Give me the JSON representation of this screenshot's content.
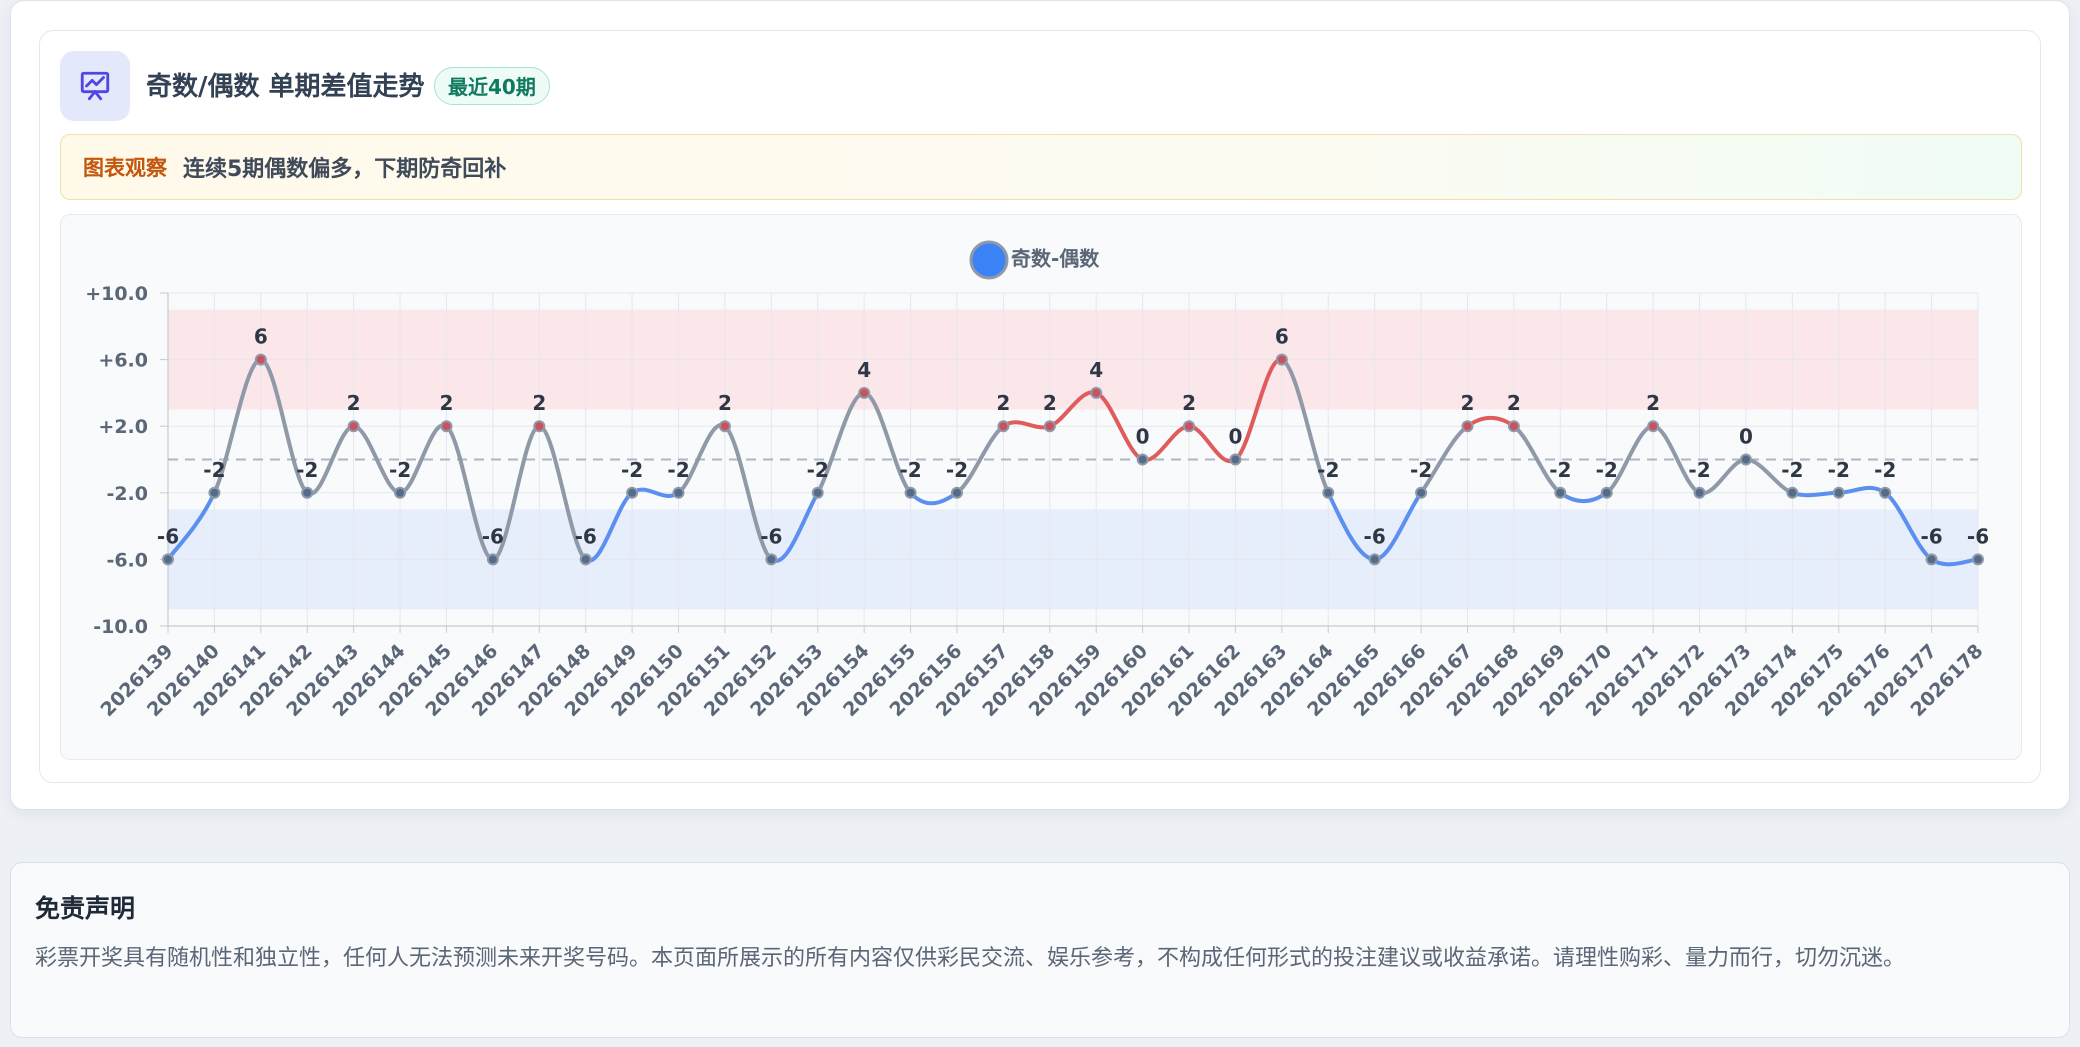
{
  "header": {
    "title": "奇数/偶数 单期差值走势",
    "badge": "最近40期"
  },
  "insight": {
    "label": "图表观察",
    "text": "连续5期偶数偏多，下期防奇回补"
  },
  "disclaimer": {
    "title": "免责声明",
    "text": "彩票开奖具有随机性和独立性，任何人无法预测未来开奖号码。本页面所展示的所有内容仅供彩民交流、娱乐参考，不构成任何形式的投注建议或收益承诺。请理性购彩、量力而行，切勿沉迷。"
  },
  "colors": {
    "positive": "#e05c5c",
    "negative": "#5b8ff0",
    "neutral": "#8f99a8",
    "legend": "#3b82f6",
    "high_band": "#fbe6e9",
    "low_band": "#e6edfb"
  },
  "chart_data": {
    "type": "line",
    "legend": {
      "label": "奇数-偶数",
      "position": "top-center"
    },
    "ylim": [
      -10,
      10
    ],
    "yticks": [
      -10,
      -6,
      -2,
      2,
      6,
      10
    ],
    "ytick_labels": [
      "-10.0",
      "-6.0",
      "-2.0",
      "+2.0",
      "+6.0",
      "+10.0"
    ],
    "reference_line": 0,
    "bands": [
      {
        "name": "high",
        "from": 3,
        "to": 9
      },
      {
        "name": "low",
        "from": -9,
        "to": -3
      }
    ],
    "grid": true,
    "categories": [
      "2026139",
      "2026140",
      "2026141",
      "2026142",
      "2026143",
      "2026144",
      "2026145",
      "2026146",
      "2026147",
      "2026148",
      "2026149",
      "2026150",
      "2026151",
      "2026152",
      "2026153",
      "2026154",
      "2026155",
      "2026156",
      "2026157",
      "2026158",
      "2026159",
      "2026160",
      "2026161",
      "2026162",
      "2026163",
      "2026164",
      "2026165",
      "2026166",
      "2026167",
      "2026168",
      "2026169",
      "2026170",
      "2026171",
      "2026172",
      "2026173",
      "2026174",
      "2026175",
      "2026176",
      "2026177",
      "2026178"
    ],
    "series": [
      {
        "name": "奇数-偶数",
        "values": [
          -6,
          -2,
          6,
          -2,
          2,
          -2,
          2,
          -6,
          2,
          -6,
          -2,
          -2,
          2,
          -6,
          -2,
          4,
          -2,
          -2,
          2,
          2,
          4,
          0,
          2,
          0,
          6,
          -2,
          -6,
          -2,
          2,
          2,
          -2,
          -2,
          2,
          -2,
          0,
          -2,
          -2,
          -2,
          -6,
          -6
        ]
      }
    ]
  }
}
